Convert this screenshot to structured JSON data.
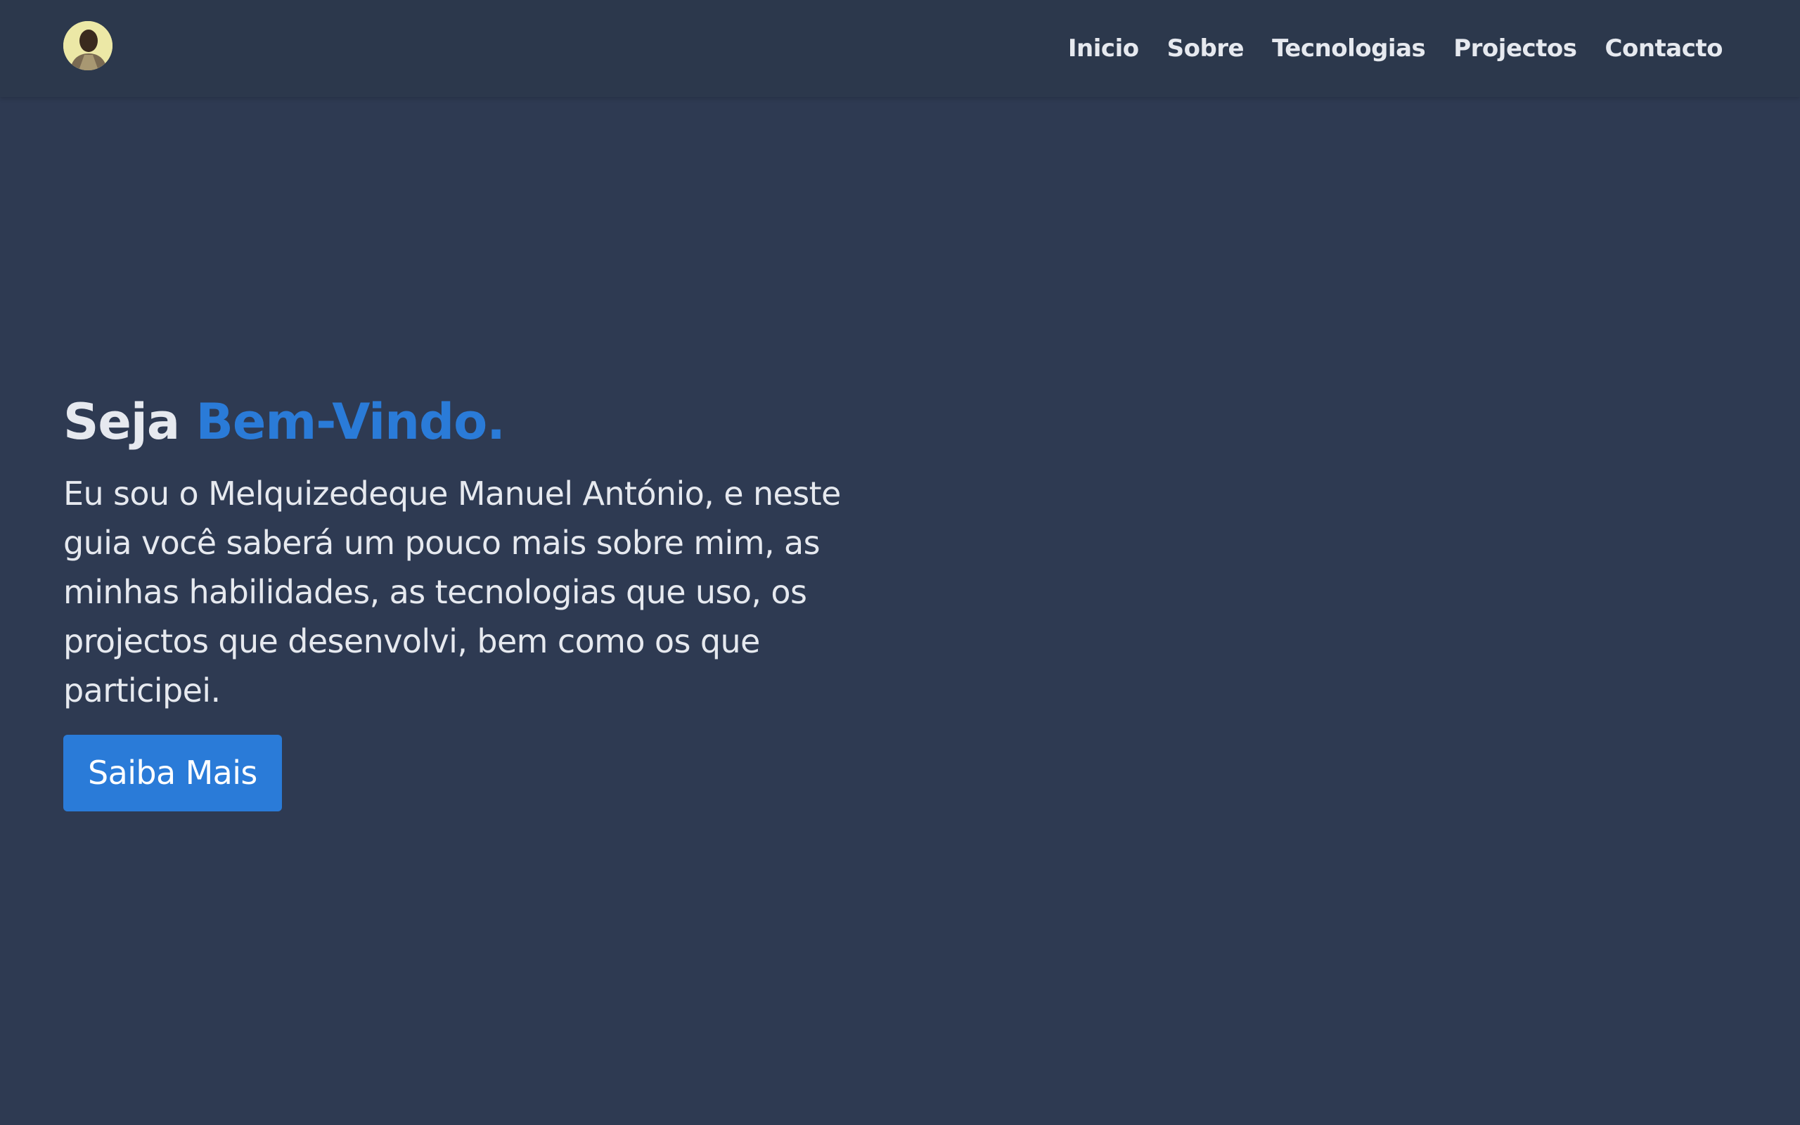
{
  "nav": {
    "avatar_icon": "profile-photo",
    "links": [
      {
        "label": "Inicio"
      },
      {
        "label": "Sobre"
      },
      {
        "label": "Tecnologias"
      },
      {
        "label": "Projectos"
      },
      {
        "label": "Contacto"
      }
    ]
  },
  "hero": {
    "title_prefix": "Seja",
    "title_accent": "Bem-Vindo.",
    "description": "Eu sou o Melquizedeque Manuel António, e neste guia você saberá um pouco mais sobre mim, as minhas habilidades, as tecnologias que uso, os projectos que desenvolvi, bem como os que participei.",
    "cta_label": "Saiba Mais"
  },
  "colors": {
    "background": "#2e3a52",
    "navbar": "#2c384c",
    "accent": "#2a7bd8",
    "text": "#e6e9ef"
  }
}
